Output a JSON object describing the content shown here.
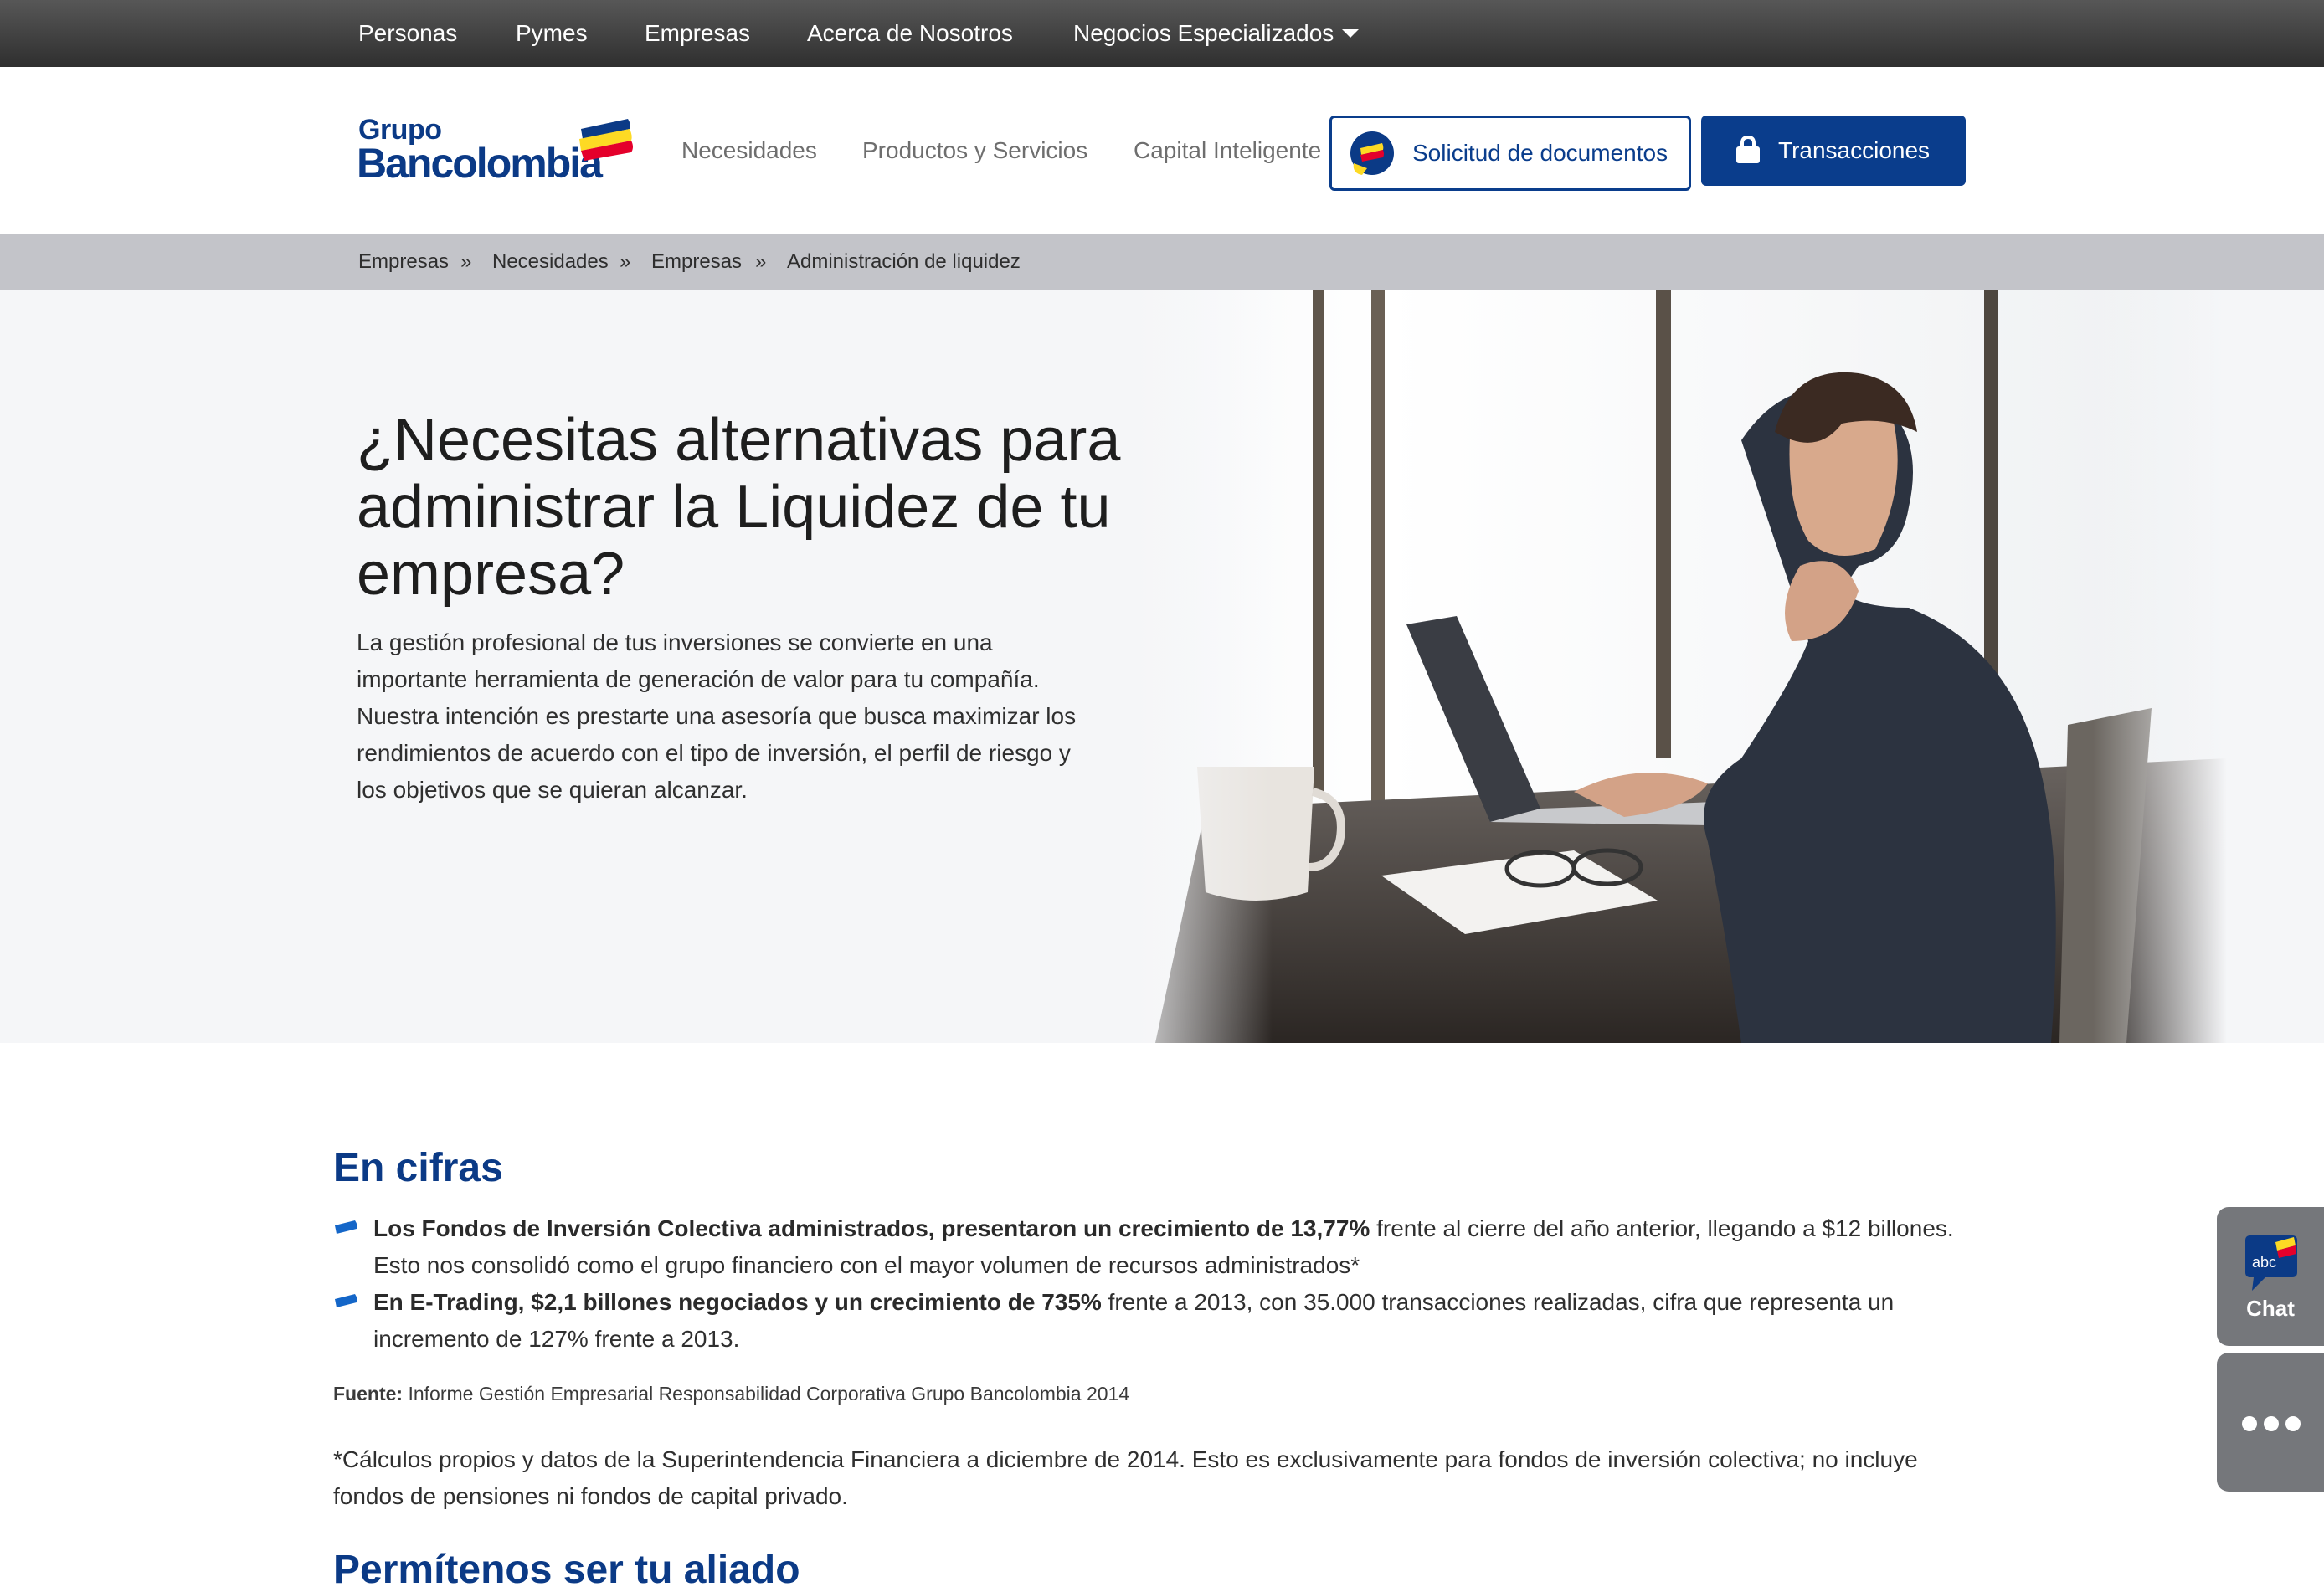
{
  "top_nav": {
    "items": [
      "Personas",
      "Pymes",
      "Empresas",
      "Acerca de Nosotros",
      "Negocios Especializados"
    ]
  },
  "header": {
    "logo": {
      "line1": "Grupo",
      "line2": "Bancolombia"
    },
    "nav": [
      "Necesidades",
      "Productos y Servicios",
      "Capital Inteligente"
    ],
    "docs_button": "Solicitud de documentos",
    "transactions_button": "Transacciones"
  },
  "breadcrumb": {
    "items": [
      "Empresas",
      "Necesidades",
      "Empresas",
      "Administración de liquidez"
    ],
    "separator": "»"
  },
  "hero": {
    "title": "¿Necesitas alternativas para administrar la Liquidez de tu empresa?",
    "description": "La gestión profesional de tus inversiones se convierte en una importante herramienta de generación de valor para tu compañía. Nuestra intención es prestarte una asesoría que busca maximizar los rendimientos de acuerdo con el tipo de inversión, el perfil de riesgo y los objetivos que se quieran alcanzar."
  },
  "figures": {
    "title": "En cifras",
    "bullets": [
      {
        "bold": "Los Fondos de Inversión Colectiva administrados, presentaron un crecimiento de 13,77%",
        "rest": " frente al cierre del año anterior, llegando a $12 billones. Esto nos consolidó como el grupo financiero con el mayor volumen de recursos administrados*"
      },
      {
        "bold": "En E-Trading, $2,1 billones negociados y un crecimiento de 735%",
        "rest": " frente a 2013, con 35.000 transacciones realizadas, cifra que representa un incremento de 127% frente a 2013."
      }
    ],
    "source_label": "Fuente:",
    "source_text": " Informe Gestión Empresarial Responsabilidad Corporativa Grupo Bancolombia 2014",
    "note": "*Cálculos propios y datos de la Superintendencia Financiera a diciembre de 2014. Esto es exclusivamente para fondos de inversión colectiva; no incluye fondos de pensiones ni fondos de capital privado."
  },
  "ally": {
    "title": "Permítenos ser tu aliado"
  },
  "side": {
    "chat_label": "Chat",
    "chat_badge": "abc"
  },
  "colors": {
    "brand_blue": "#0a3d8c",
    "topbar": "#3f3f3f",
    "breadcrumb_bg": "#c3c4c9",
    "accent_yellow": "#fdda24",
    "accent_red": "#e4002b"
  }
}
